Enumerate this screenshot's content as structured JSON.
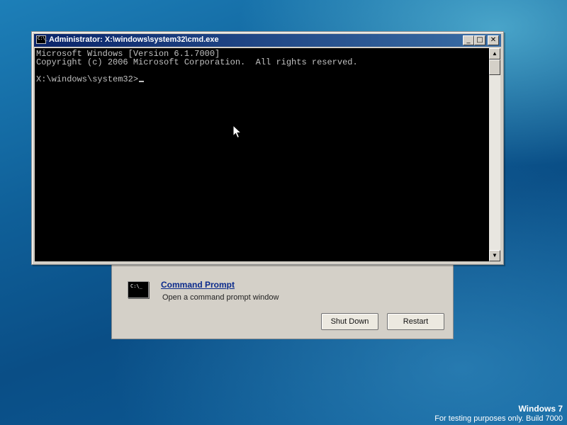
{
  "cmd_window": {
    "title": "Administrator: X:\\windows\\system32\\cmd.exe",
    "icon_text": "C:\\_",
    "buttons": {
      "minimize": "minimize-icon",
      "maximize": "maximize-icon",
      "close": "close-icon"
    },
    "console_lines": [
      "Microsoft Windows [Version 6.1.7000]",
      "Copyright (c) 2006 Microsoft Corporation.  All rights reserved.",
      "",
      "X:\\windows\\system32>"
    ]
  },
  "recovery_dialog": {
    "item_icon_text": "C:\\_",
    "item_link": "Command Prompt",
    "item_description": "Open a command prompt window",
    "shutdown_label": "Shut Down",
    "restart_label": "Restart"
  },
  "watermark": {
    "title": "Windows 7",
    "subtitle": "For testing purposes only. Build 7000"
  }
}
